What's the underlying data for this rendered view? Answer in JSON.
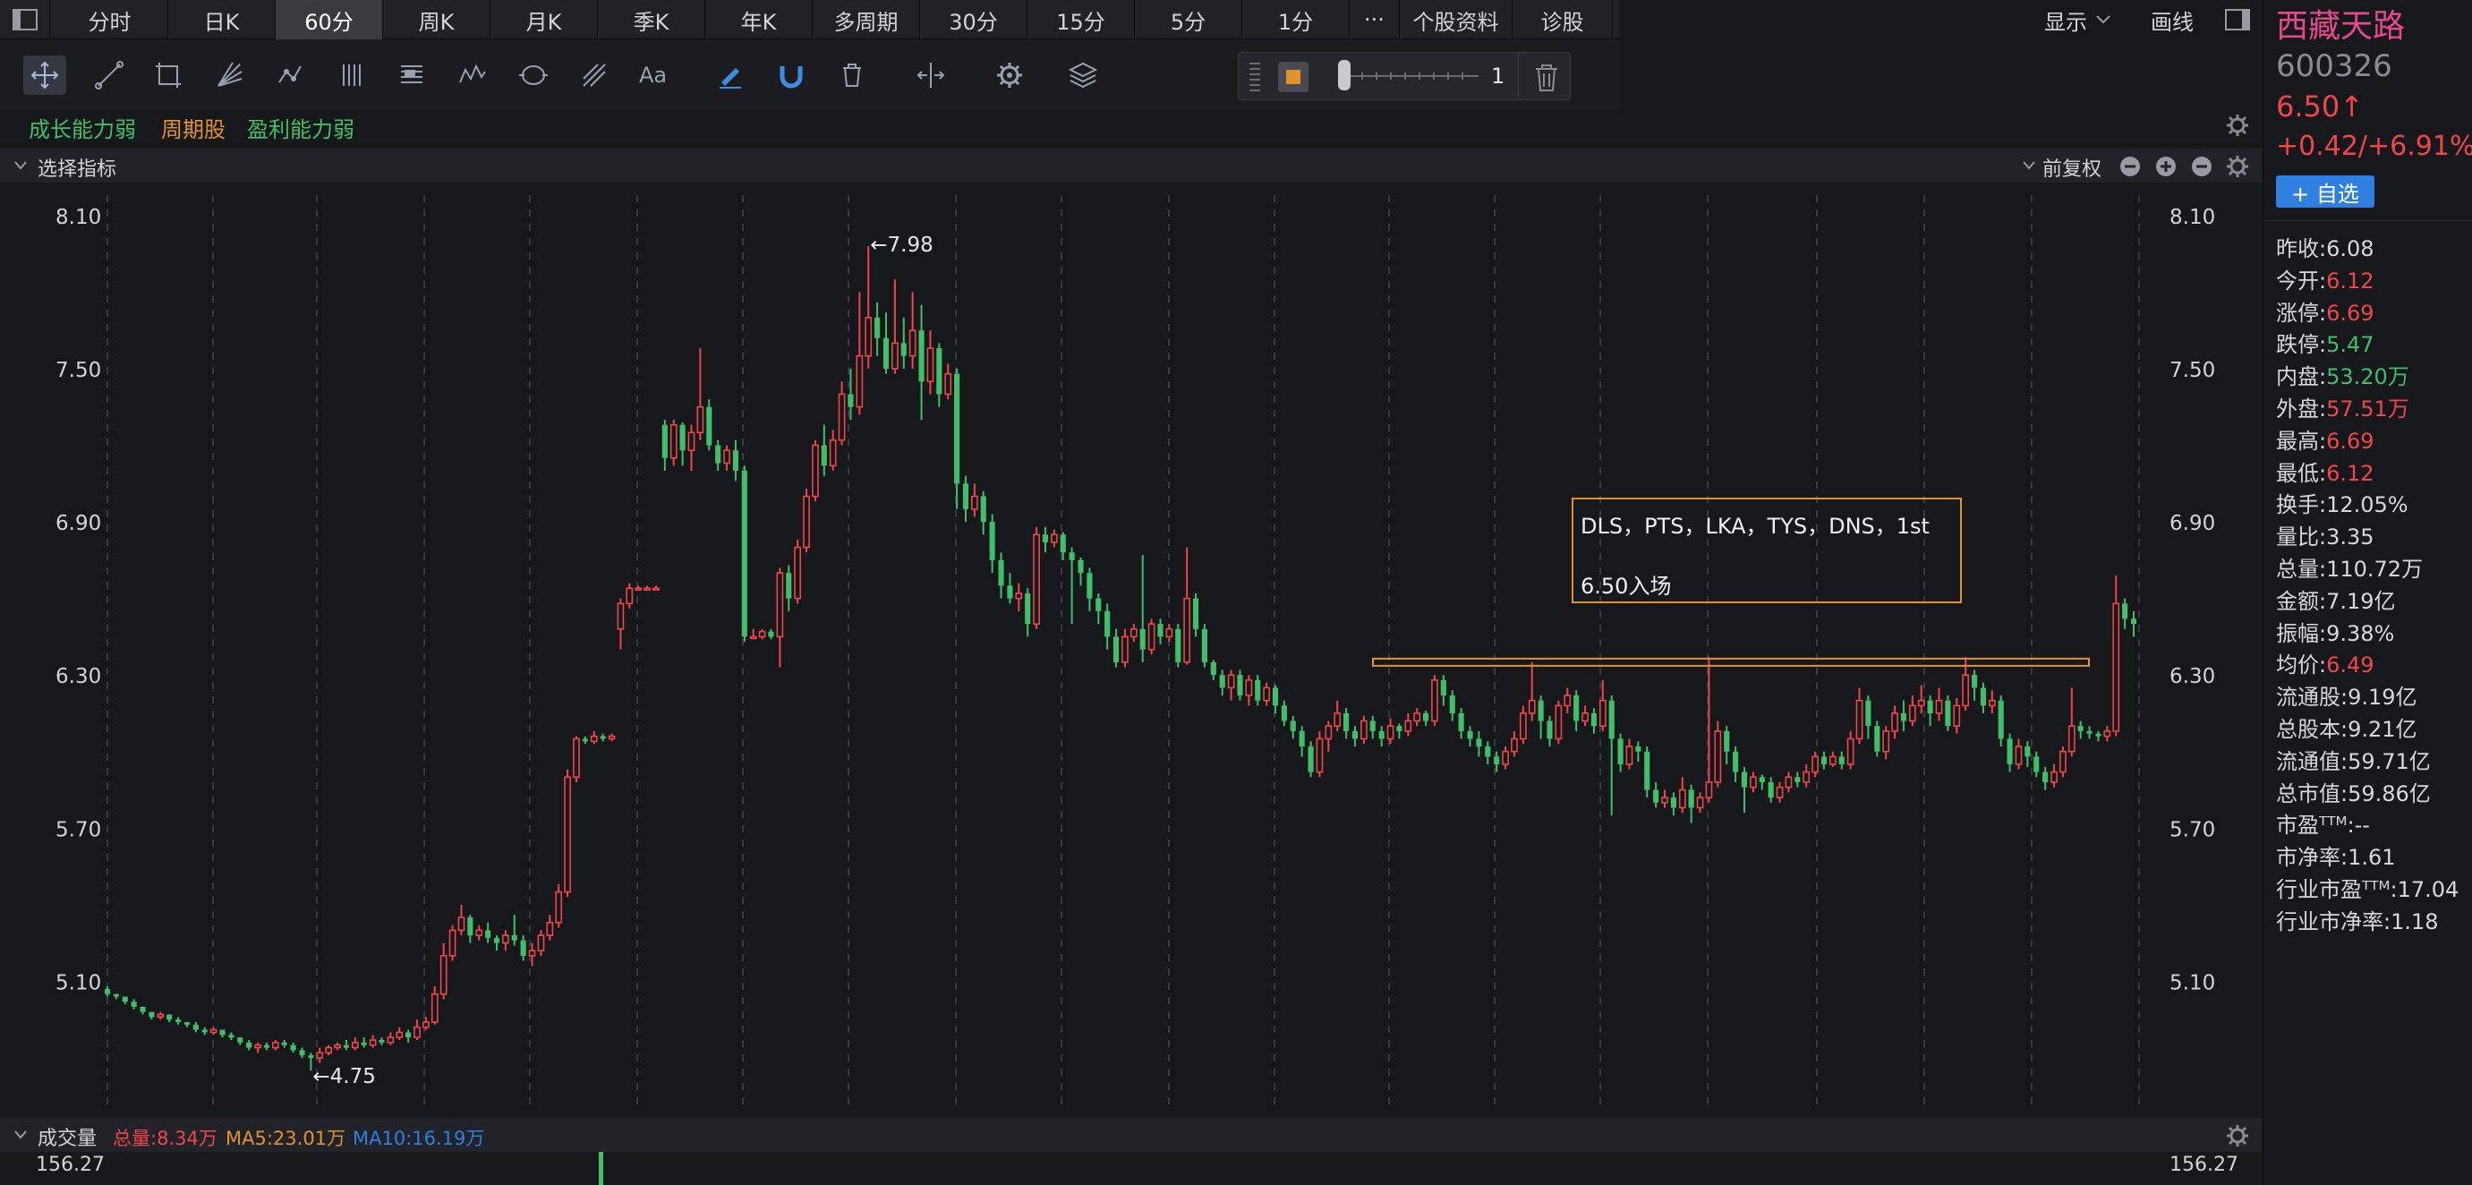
{
  "tabs": [
    "分时",
    "日K",
    "60分",
    "周K",
    "月K",
    "季K",
    "年K",
    "多周期",
    "30分",
    "15分",
    "5分",
    "1分",
    "···",
    "个股资料",
    "诊股"
  ],
  "tab_active": "60分",
  "toolbar_right": {
    "display": "显示",
    "draw": "画线"
  },
  "brush_value": "1",
  "tags": [
    {
      "label": "成长能力弱",
      "color": "#3fbf6a"
    },
    {
      "label": "周期股",
      "color": "#e0922c"
    },
    {
      "label": "盈利能力弱",
      "color": "#3fbf6a"
    }
  ],
  "indicator_header": {
    "label": "选择指标",
    "fq": "前复权"
  },
  "volume_header": {
    "label": "成交量",
    "total": "总量:8.34万",
    "ma5": "MA5:23.01万",
    "ma10": "MA10:16.19万"
  },
  "volume_scale": "156.27",
  "annotation": {
    "line1": "DLS，PTS，LKA，TYS，DNS，1st",
    "line2": "6.50入场"
  },
  "stock": {
    "name": "西藏天路",
    "code": "600326",
    "price": "6.50↑",
    "change": "+0.42/+6.91%",
    "add_button": "+ 自选",
    "stats": [
      {
        "label": "昨收:",
        "value": "6.08",
        "color": "#d8d8dc"
      },
      {
        "label": "今开:",
        "value": "6.12",
        "color": "#f0454a"
      },
      {
        "label": "涨停:",
        "value": "6.69",
        "color": "#f0454a"
      },
      {
        "label": "跌停:",
        "value": "5.47",
        "color": "#3fbf6a"
      },
      {
        "label": "内盘:",
        "value": "53.20万",
        "color": "#3fbf6a"
      },
      {
        "label": "外盘:",
        "value": "57.51万",
        "color": "#f0454a"
      },
      {
        "label": "最高:",
        "value": "6.69",
        "color": "#f0454a"
      },
      {
        "label": "最低:",
        "value": "6.12",
        "color": "#f0454a"
      },
      {
        "label": "换手:",
        "value": "12.05%",
        "color": "#d8d8dc"
      },
      {
        "label": "量比:",
        "value": "3.35",
        "color": "#d8d8dc"
      },
      {
        "label": "总量:",
        "value": "110.72万",
        "color": "#d8d8dc"
      },
      {
        "label": "金额:",
        "value": "7.19亿",
        "color": "#d8d8dc"
      },
      {
        "label": "振幅:",
        "value": "9.38%",
        "color": "#d8d8dc"
      },
      {
        "label": "均价:",
        "value": "6.49",
        "color": "#f0454a"
      },
      {
        "label": "流通股:",
        "value": "9.19亿",
        "color": "#d8d8dc"
      },
      {
        "label": "总股本:",
        "value": "9.21亿",
        "color": "#d8d8dc"
      },
      {
        "label": "流通值:",
        "value": "59.71亿",
        "color": "#d8d8dc"
      },
      {
        "label": "总市值:",
        "value": "59.86亿",
        "color": "#d8d8dc"
      },
      {
        "label": "市盈ᵀᵀᴹ:",
        "value": "--",
        "color": "#d8d8dc"
      },
      {
        "label": "市净率:",
        "value": "1.61",
        "color": "#d8d8dc"
      },
      {
        "label": "行业市盈ᵀᵀᴹ:",
        "value": "17.04",
        "color": "#d8d8dc"
      },
      {
        "label": "行业市净率:",
        "value": "1.18",
        "color": "#d8d8dc"
      }
    ]
  },
  "colors": {
    "up": "#f0454a",
    "down": "#3fbf6a",
    "accent": "#e0922c",
    "link": "#2f7fe0",
    "name": "#e8488c"
  },
  "chart_data": {
    "type": "candlestick",
    "yticks": [
      8.1,
      7.5,
      6.9,
      6.3,
      5.7,
      5.1
    ],
    "ylim": [
      4.6,
      8.18
    ],
    "ymax_label": "←7.98",
    "ymin_label": "←4.75",
    "resistance_level": 6.35,
    "candles": [
      [
        5.07,
        5.05,
        5.08,
        5.04
      ],
      [
        5.05,
        5.04,
        5.05,
        5.03
      ],
      [
        5.04,
        5.02,
        5.04,
        5.01
      ],
      [
        5.02,
        5.0,
        5.03,
        4.99
      ],
      [
        5.0,
        4.98,
        5.0,
        4.97
      ],
      [
        4.98,
        4.96,
        4.98,
        4.95
      ],
      [
        4.96,
        4.97,
        4.98,
        4.95
      ],
      [
        4.97,
        4.95,
        4.97,
        4.94
      ],
      [
        4.95,
        4.94,
        4.96,
        4.93
      ],
      [
        4.94,
        4.93,
        4.94,
        4.92
      ],
      [
        4.93,
        4.91,
        4.94,
        4.9
      ],
      [
        4.91,
        4.9,
        4.92,
        4.89
      ],
      [
        4.9,
        4.91,
        4.92,
        4.89
      ],
      [
        4.91,
        4.89,
        4.91,
        4.88
      ],
      [
        4.89,
        4.88,
        4.9,
        4.87
      ],
      [
        4.88,
        4.86,
        4.88,
        4.85
      ],
      [
        4.86,
        4.84,
        4.87,
        4.83
      ],
      [
        4.84,
        4.85,
        4.86,
        4.82
      ],
      [
        4.85,
        4.84,
        4.86,
        4.83
      ],
      [
        4.84,
        4.86,
        4.87,
        4.83
      ],
      [
        4.86,
        4.85,
        4.87,
        4.84
      ],
      [
        4.85,
        4.83,
        4.86,
        4.82
      ],
      [
        4.83,
        4.81,
        4.84,
        4.8
      ],
      [
        4.81,
        4.8,
        4.82,
        4.75
      ],
      [
        4.8,
        4.82,
        4.84,
        4.78
      ],
      [
        4.82,
        4.84,
        4.85,
        4.81
      ],
      [
        4.84,
        4.85,
        4.86,
        4.83
      ],
      [
        4.85,
        4.84,
        4.87,
        4.83
      ],
      [
        4.84,
        4.86,
        4.88,
        4.83
      ],
      [
        4.86,
        4.85,
        4.88,
        4.84
      ],
      [
        4.85,
        4.87,
        4.89,
        4.84
      ],
      [
        4.87,
        4.86,
        4.88,
        4.85
      ],
      [
        4.86,
        4.88,
        4.9,
        4.85
      ],
      [
        4.88,
        4.9,
        4.92,
        4.87
      ],
      [
        4.9,
        4.88,
        4.91,
        4.86
      ],
      [
        4.88,
        4.92,
        4.95,
        4.87
      ],
      [
        4.92,
        4.94,
        4.96,
        4.91
      ],
      [
        4.94,
        5.05,
        5.08,
        4.93
      ],
      [
        5.05,
        5.2,
        5.25,
        5.03
      ],
      [
        5.2,
        5.3,
        5.32,
        5.18
      ],
      [
        5.3,
        5.35,
        5.4,
        5.28
      ],
      [
        5.35,
        5.28,
        5.36,
        5.25
      ],
      [
        5.28,
        5.3,
        5.32,
        5.26
      ],
      [
        5.3,
        5.27,
        5.33,
        5.25
      ],
      [
        5.27,
        5.25,
        5.28,
        5.22
      ],
      [
        5.25,
        5.28,
        5.3,
        5.22
      ],
      [
        5.28,
        5.26,
        5.36,
        5.24
      ],
      [
        5.26,
        5.2,
        5.28,
        5.18
      ],
      [
        5.2,
        5.22,
        5.25,
        5.16
      ],
      [
        5.22,
        5.28,
        5.3,
        5.2
      ],
      [
        5.28,
        5.33,
        5.36,
        5.26
      ],
      [
        5.33,
        5.45,
        5.48,
        5.31
      ],
      [
        5.45,
        5.9,
        5.93,
        5.43
      ],
      [
        5.9,
        6.05,
        6.06,
        5.88
      ],
      [
        6.05,
        6.04,
        6.06,
        6.03
      ],
      [
        6.04,
        6.06,
        6.08,
        6.03
      ],
      [
        6.06,
        6.05,
        6.07,
        6.04
      ],
      [
        6.05,
        6.06,
        6.07,
        6.04
      ],
      [
        6.48,
        6.58,
        6.6,
        6.4
      ],
      [
        6.58,
        6.64,
        6.66,
        6.56
      ],
      [
        6.64,
        6.64,
        6.65,
        6.63
      ],
      [
        6.64,
        6.64,
        6.65,
        6.63
      ],
      [
        6.64,
        6.64,
        6.65,
        6.63
      ],
      [
        7.28,
        7.15,
        7.3,
        7.1
      ],
      [
        7.15,
        7.28,
        7.3,
        7.12
      ],
      [
        7.28,
        7.18,
        7.29,
        7.12
      ],
      [
        7.18,
        7.25,
        7.28,
        7.1
      ],
      [
        7.25,
        7.35,
        7.58,
        7.22
      ],
      [
        7.35,
        7.2,
        7.38,
        7.18
      ],
      [
        7.2,
        7.13,
        7.22,
        7.1
      ],
      [
        7.13,
        7.18,
        7.2,
        7.1
      ],
      [
        7.18,
        7.1,
        7.22,
        7.06
      ],
      [
        7.1,
        6.45,
        7.12,
        6.43
      ],
      [
        6.45,
        6.45,
        6.48,
        6.44
      ],
      [
        6.45,
        6.47,
        6.48,
        6.44
      ],
      [
        6.47,
        6.45,
        6.48,
        6.44
      ],
      [
        6.45,
        6.7,
        6.72,
        6.33
      ],
      [
        6.7,
        6.6,
        6.73,
        6.55
      ],
      [
        6.6,
        6.8,
        6.83,
        6.58
      ],
      [
        6.8,
        7.0,
        7.03,
        6.78
      ],
      [
        7.0,
        7.2,
        7.22,
        6.98
      ],
      [
        7.2,
        7.12,
        7.28,
        7.08
      ],
      [
        7.12,
        7.22,
        7.26,
        7.1
      ],
      [
        7.22,
        7.4,
        7.45,
        7.2
      ],
      [
        7.4,
        7.35,
        7.5,
        7.3
      ],
      [
        7.35,
        7.55,
        7.8,
        7.32
      ],
      [
        7.55,
        7.7,
        7.98,
        7.5
      ],
      [
        7.7,
        7.62,
        7.76,
        7.55
      ],
      [
        7.62,
        7.5,
        7.72,
        7.48
      ],
      [
        7.5,
        7.6,
        7.85,
        7.48
      ],
      [
        7.6,
        7.55,
        7.7,
        7.5
      ],
      [
        7.55,
        7.65,
        7.8,
        7.5
      ],
      [
        7.65,
        7.45,
        7.75,
        7.3
      ],
      [
        7.45,
        7.58,
        7.65,
        7.4
      ],
      [
        7.58,
        7.4,
        7.6,
        7.35
      ],
      [
        7.4,
        7.48,
        7.52,
        7.38
      ],
      [
        7.48,
        7.05,
        7.5,
        6.95
      ],
      [
        7.05,
        6.95,
        7.08,
        6.9
      ],
      [
        6.95,
        7.0,
        7.05,
        6.92
      ],
      [
        7.0,
        6.9,
        7.02,
        6.85
      ],
      [
        6.9,
        6.75,
        6.93,
        6.7
      ],
      [
        6.75,
        6.65,
        6.78,
        6.6
      ],
      [
        6.65,
        6.6,
        6.7,
        6.58
      ],
      [
        6.6,
        6.62,
        6.66,
        6.55
      ],
      [
        6.62,
        6.5,
        6.64,
        6.45
      ],
      [
        6.5,
        6.85,
        6.88,
        6.48
      ],
      [
        6.85,
        6.82,
        6.88,
        6.78
      ],
      [
        6.82,
        6.85,
        6.87,
        6.8
      ],
      [
        6.85,
        6.78,
        6.86,
        6.75
      ],
      [
        6.78,
        6.75,
        6.8,
        6.5
      ],
      [
        6.75,
        6.7,
        6.76,
        6.65
      ],
      [
        6.7,
        6.6,
        6.72,
        6.55
      ],
      [
        6.6,
        6.55,
        6.62,
        6.5
      ],
      [
        6.55,
        6.45,
        6.58,
        6.4
      ],
      [
        6.45,
        6.35,
        6.48,
        6.33
      ],
      [
        6.35,
        6.45,
        6.48,
        6.33
      ],
      [
        6.45,
        6.48,
        6.5,
        6.43
      ],
      [
        6.48,
        6.4,
        6.77,
        6.35
      ],
      [
        6.4,
        6.5,
        6.52,
        6.38
      ],
      [
        6.5,
        6.45,
        6.52,
        6.42
      ],
      [
        6.45,
        6.48,
        6.5,
        6.43
      ],
      [
        6.48,
        6.35,
        6.5,
        6.33
      ],
      [
        6.35,
        6.6,
        6.8,
        6.34
      ],
      [
        6.6,
        6.48,
        6.62,
        6.45
      ],
      [
        6.48,
        6.35,
        6.5,
        6.33
      ],
      [
        6.35,
        6.3,
        6.36,
        6.28
      ],
      [
        6.3,
        6.25,
        6.32,
        6.22
      ],
      [
        6.25,
        6.3,
        6.32,
        6.2
      ],
      [
        6.3,
        6.22,
        6.32,
        6.2
      ],
      [
        6.22,
        6.28,
        6.3,
        6.18
      ],
      [
        6.28,
        6.2,
        6.3,
        6.18
      ],
      [
        6.2,
        6.25,
        6.27,
        6.18
      ],
      [
        6.25,
        6.18,
        6.26,
        6.15
      ],
      [
        6.18,
        6.12,
        6.2,
        6.1
      ],
      [
        6.12,
        6.08,
        6.14,
        6.05
      ],
      [
        6.08,
        6.02,
        6.1,
        5.98
      ],
      [
        6.02,
        5.92,
        6.04,
        5.9
      ],
      [
        5.92,
        6.05,
        6.08,
        5.9
      ],
      [
        6.05,
        6.1,
        6.12,
        6.0
      ],
      [
        6.1,
        6.15,
        6.2,
        6.08
      ],
      [
        6.15,
        6.08,
        6.17,
        6.05
      ],
      [
        6.08,
        6.05,
        6.1,
        6.02
      ],
      [
        6.05,
        6.12,
        6.14,
        6.03
      ],
      [
        6.12,
        6.08,
        6.14,
        6.05
      ],
      [
        6.08,
        6.05,
        6.1,
        6.02
      ],
      [
        6.05,
        6.1,
        6.13,
        6.03
      ],
      [
        6.1,
        6.08,
        6.11,
        6.05
      ],
      [
        6.08,
        6.12,
        6.15,
        6.06
      ],
      [
        6.12,
        6.15,
        6.17,
        6.1
      ],
      [
        6.15,
        6.12,
        6.16,
        6.1
      ],
      [
        6.12,
        6.28,
        6.3,
        6.1
      ],
      [
        6.28,
        6.22,
        6.3,
        6.18
      ],
      [
        6.22,
        6.15,
        6.24,
        6.12
      ],
      [
        6.15,
        6.08,
        6.17,
        6.05
      ],
      [
        6.08,
        6.05,
        6.1,
        6.02
      ],
      [
        6.05,
        6.02,
        6.08,
        5.98
      ],
      [
        6.02,
        5.98,
        6.04,
        5.95
      ],
      [
        5.98,
        5.95,
        6.0,
        5.92
      ],
      [
        5.95,
        6.0,
        6.02,
        5.93
      ],
      [
        6.0,
        6.05,
        6.08,
        5.98
      ],
      [
        6.05,
        6.15,
        6.18,
        6.03
      ],
      [
        6.15,
        6.2,
        6.35,
        6.12
      ],
      [
        6.2,
        6.12,
        6.22,
        6.05
      ],
      [
        6.12,
        6.05,
        6.14,
        6.02
      ],
      [
        6.05,
        6.18,
        6.2,
        6.03
      ],
      [
        6.18,
        6.22,
        6.25,
        6.15
      ],
      [
        6.22,
        6.12,
        6.24,
        6.08
      ],
      [
        6.12,
        6.15,
        6.18,
        6.1
      ],
      [
        6.15,
        6.1,
        6.17,
        6.07
      ],
      [
        6.1,
        6.2,
        6.28,
        6.08
      ],
      [
        6.2,
        6.05,
        6.22,
        5.75
      ],
      [
        6.05,
        5.95,
        6.07,
        5.92
      ],
      [
        5.95,
        6.02,
        6.05,
        5.93
      ],
      [
        6.02,
        6.0,
        6.04,
        5.96
      ],
      [
        6.0,
        5.85,
        6.02,
        5.82
      ],
      [
        5.85,
        5.8,
        5.88,
        5.78
      ],
      [
        5.8,
        5.82,
        5.85,
        5.78
      ],
      [
        5.82,
        5.78,
        5.84,
        5.75
      ],
      [
        5.78,
        5.85,
        5.9,
        5.76
      ],
      [
        5.85,
        5.78,
        5.87,
        5.72
      ],
      [
        5.78,
        5.82,
        5.84,
        5.76
      ],
      [
        5.82,
        5.88,
        6.37,
        5.8
      ],
      [
        5.88,
        6.08,
        6.12,
        5.86
      ],
      [
        6.08,
        6.0,
        6.1,
        5.95
      ],
      [
        6.0,
        5.92,
        6.02,
        5.88
      ],
      [
        5.92,
        5.86,
        5.94,
        5.76
      ],
      [
        5.86,
        5.9,
        5.92,
        5.84
      ],
      [
        5.9,
        5.88,
        5.91,
        5.85
      ],
      [
        5.88,
        5.82,
        5.9,
        5.8
      ],
      [
        5.82,
        5.86,
        5.88,
        5.8
      ],
      [
        5.86,
        5.9,
        5.92,
        5.84
      ],
      [
        5.9,
        5.88,
        5.92,
        5.86
      ],
      [
        5.88,
        5.92,
        5.95,
        5.86
      ],
      [
        5.92,
        5.98,
        6.0,
        5.9
      ],
      [
        5.98,
        5.95,
        6.0,
        5.93
      ],
      [
        5.95,
        5.98,
        6.0,
        5.94
      ],
      [
        5.98,
        5.95,
        6.0,
        5.93
      ],
      [
        5.95,
        6.05,
        6.08,
        5.93
      ],
      [
        6.05,
        6.2,
        6.25,
        6.03
      ],
      [
        6.2,
        6.1,
        6.22,
        6.05
      ],
      [
        6.1,
        6.0,
        6.12,
        5.98
      ],
      [
        6.0,
        6.08,
        6.1,
        5.97
      ],
      [
        6.08,
        6.15,
        6.18,
        6.05
      ],
      [
        6.15,
        6.12,
        6.2,
        6.08
      ],
      [
        6.12,
        6.18,
        6.22,
        6.1
      ],
      [
        6.18,
        6.2,
        6.26,
        6.15
      ],
      [
        6.2,
        6.15,
        6.22,
        6.1
      ],
      [
        6.15,
        6.2,
        6.25,
        6.12
      ],
      [
        6.2,
        6.1,
        6.22,
        6.08
      ],
      [
        6.1,
        6.18,
        6.21,
        6.07
      ],
      [
        6.18,
        6.3,
        6.37,
        6.16
      ],
      [
        6.3,
        6.25,
        6.32,
        6.2
      ],
      [
        6.25,
        6.18,
        6.27,
        6.15
      ],
      [
        6.18,
        6.2,
        6.24,
        6.15
      ],
      [
        6.2,
        6.05,
        6.22,
        6.02
      ],
      [
        6.05,
        5.95,
        6.07,
        5.92
      ],
      [
        5.95,
        6.02,
        6.05,
        5.93
      ],
      [
        6.02,
        5.98,
        6.04,
        5.94
      ],
      [
        5.98,
        5.92,
        6.0,
        5.9
      ],
      [
        5.92,
        5.88,
        5.94,
        5.85
      ],
      [
        5.88,
        5.92,
        5.95,
        5.86
      ],
      [
        5.92,
        6.0,
        6.02,
        5.9
      ],
      [
        6.0,
        6.1,
        6.25,
        5.98
      ],
      [
        6.1,
        6.08,
        6.12,
        6.05
      ],
      [
        6.08,
        6.07,
        6.1,
        6.05
      ],
      [
        6.07,
        6.06,
        6.08,
        6.04
      ],
      [
        6.06,
        6.08,
        6.1,
        6.04
      ],
      [
        6.08,
        6.58,
        6.69,
        6.06
      ],
      [
        6.58,
        6.52,
        6.6,
        6.48
      ],
      [
        6.52,
        6.5,
        6.55,
        6.45
      ]
    ]
  }
}
